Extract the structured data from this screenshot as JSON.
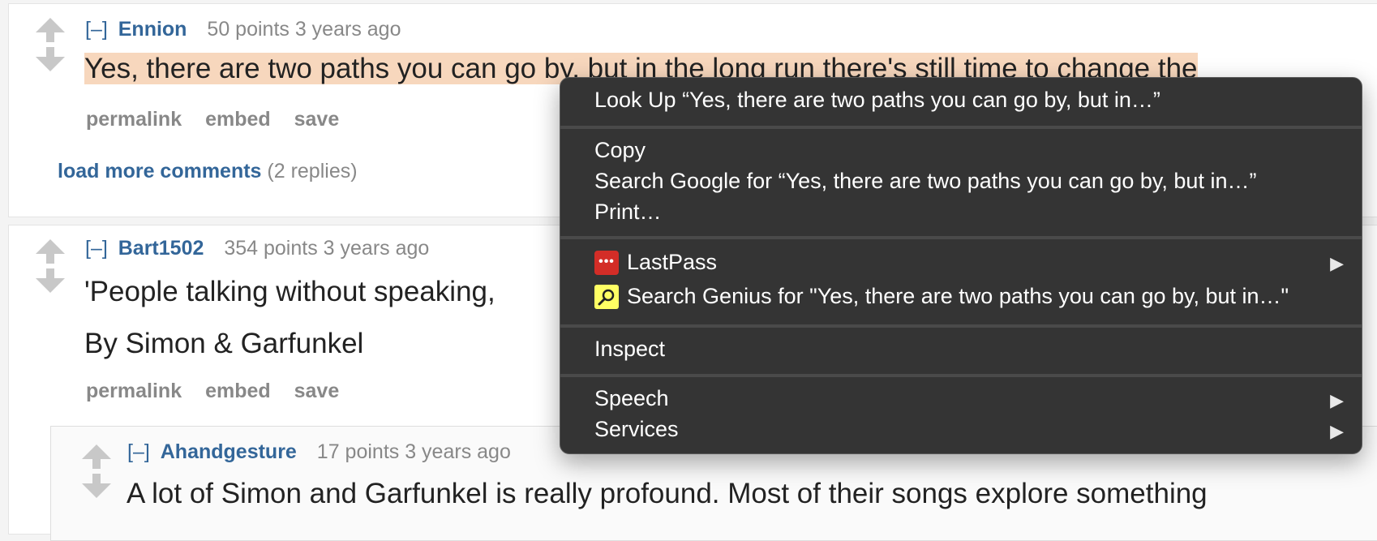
{
  "comments": [
    {
      "toggle": "[–]",
      "author": "Ennion",
      "meta": "50 points 3 years ago",
      "body_highlighted": "Yes, there are two paths you can go by, but in the long run there's still time to change the",
      "buttons": {
        "permalink": "permalink",
        "embed": "embed",
        "save": "save"
      },
      "load_more": {
        "link": "load more comments",
        "count": "(2 replies)"
      }
    },
    {
      "toggle": "[–]",
      "author": "Bart1502",
      "meta": "354 points 3 years ago",
      "body_line1": "'People talking without speaking,",
      "body_line2": "By Simon & Garfunkel",
      "buttons": {
        "permalink": "permalink",
        "embed": "embed",
        "save": "save"
      }
    },
    {
      "toggle": "[–]",
      "author": "Ahandgesture",
      "meta": "17 points 3 years ago",
      "body": "A lot of Simon and Garfunkel is really profound. Most of their songs explore something"
    }
  ],
  "context_menu": {
    "look_up": "Look Up “Yes, there are two paths you can go by, but in…”",
    "copy": "Copy",
    "search_google": "Search Google for “Yes, there are two paths you can go by, but in…”",
    "print": "Print…",
    "lastpass": "LastPass",
    "lastpass_icon_text": "•••",
    "search_genius": "Search Genius for \"Yes, there are two paths you can go by, but in…\"",
    "inspect": "Inspect",
    "speech": "Speech",
    "services": "Services",
    "submenu_arrow": "▶",
    "icons": {
      "lastpass": "lastpass-icon",
      "genius": "magnifier-icon",
      "submenu": "submenu-arrow-icon"
    }
  }
}
